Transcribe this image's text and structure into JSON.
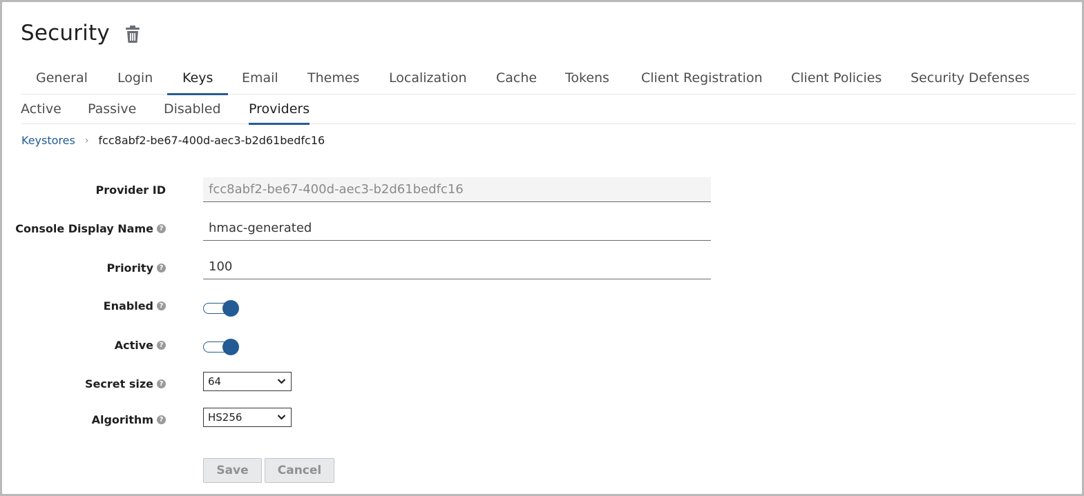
{
  "page": {
    "title": "Security"
  },
  "tabs": [
    {
      "label": "General",
      "active": false
    },
    {
      "label": "Login",
      "active": false
    },
    {
      "label": "Keys",
      "active": true
    },
    {
      "label": "Email",
      "active": false
    },
    {
      "label": "Themes",
      "active": false
    },
    {
      "label": "Localization",
      "active": false
    },
    {
      "label": "Cache",
      "active": false
    },
    {
      "label": "Tokens",
      "active": false
    },
    {
      "label": "Client Registration",
      "active": false
    },
    {
      "label": "Client Policies",
      "active": false
    },
    {
      "label": "Security Defenses",
      "active": false
    }
  ],
  "subtabs": [
    {
      "label": "Active",
      "active": false
    },
    {
      "label": "Passive",
      "active": false
    },
    {
      "label": "Disabled",
      "active": false
    },
    {
      "label": "Providers",
      "active": true
    }
  ],
  "breadcrumb": {
    "parent": "Keystores",
    "separator": "›",
    "current": "fcc8abf2-be67-400d-aec3-b2d61bedfc16"
  },
  "form": {
    "provider_id": {
      "label": "Provider ID",
      "value": "fcc8abf2-be67-400d-aec3-b2d61bedfc16"
    },
    "display_name": {
      "label": "Console Display Name",
      "value": "hmac-generated"
    },
    "priority": {
      "label": "Priority",
      "value": "100"
    },
    "enabled": {
      "label": "Enabled",
      "on": true
    },
    "active": {
      "label": "Active",
      "on": true
    },
    "secret_size": {
      "label": "Secret size",
      "value": "64"
    },
    "algorithm": {
      "label": "Algorithm",
      "value": "HS256"
    },
    "help_glyph": "?"
  },
  "buttons": {
    "save": "Save",
    "cancel": "Cancel"
  },
  "colors": {
    "accent": "#235c94",
    "link": "#235c94"
  }
}
